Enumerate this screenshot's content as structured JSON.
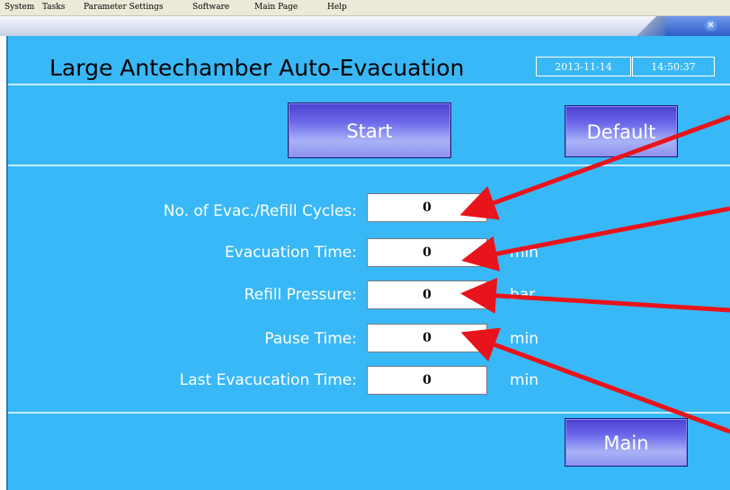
{
  "menu": [
    "System",
    "Tasks",
    "Parameter Settings",
    "Software",
    "Main Page",
    "Help"
  ],
  "window": {
    "close_glyph": "✕"
  },
  "header": {
    "title": "Large Antechamber Auto-Evacuation",
    "date": "2013-11-14",
    "time": "14:50:37"
  },
  "buttons": {
    "start": "Start",
    "default": "Default",
    "main": "Main"
  },
  "fields": [
    {
      "label": "No. of Evac./Refill Cycles:",
      "value": "0",
      "unit": ""
    },
    {
      "label": "Evacuation Time:",
      "value": "0",
      "unit": "min"
    },
    {
      "label": "Refill Pressure:",
      "value": "0",
      "unit": "bar"
    },
    {
      "label": "Pause Time:",
      "value": "0",
      "unit": "min"
    },
    {
      "label": "Last Evacucation Time:",
      "value": "0",
      "unit": "min"
    }
  ],
  "colors": {
    "panel": "#39b8f7",
    "button": "#6d69ea",
    "arrow": "#e8141b"
  },
  "icons": {
    "close": "close-icon",
    "annotation": "red-arrow-annotation"
  }
}
